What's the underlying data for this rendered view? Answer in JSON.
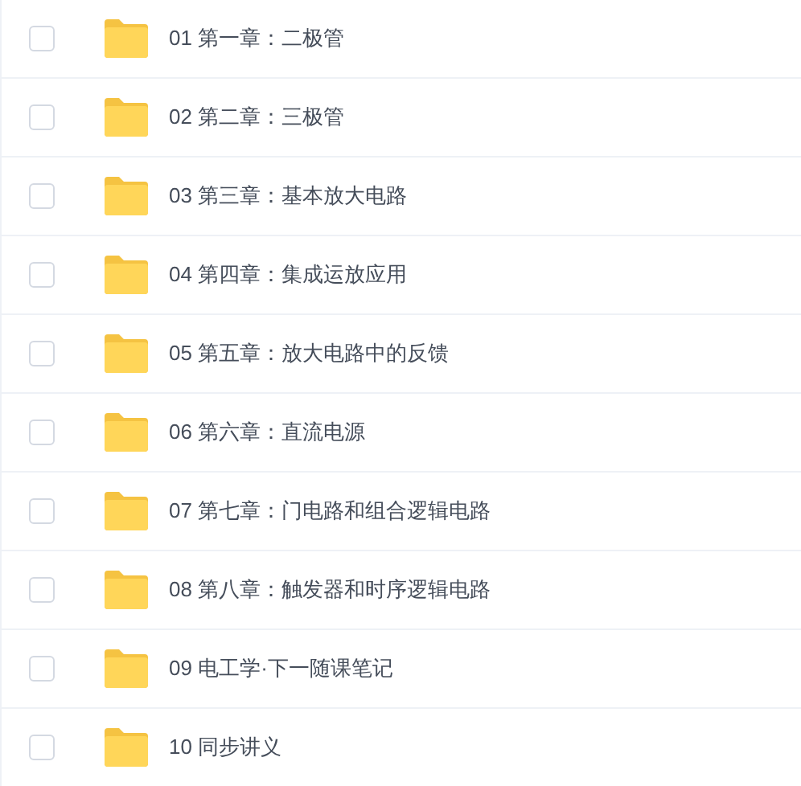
{
  "files": [
    {
      "name": "01 第一章：二极管",
      "checked": false
    },
    {
      "name": "02 第二章：三极管",
      "checked": false
    },
    {
      "name": "03 第三章：基本放大电路",
      "checked": false
    },
    {
      "name": "04 第四章：集成运放应用",
      "checked": false
    },
    {
      "name": "05 第五章：放大电路中的反馈",
      "checked": false
    },
    {
      "name": "06 第六章：直流电源",
      "checked": false
    },
    {
      "name": "07 第七章：门电路和组合逻辑电路",
      "checked": false
    },
    {
      "name": "08 第八章：触发器和时序逻辑电路",
      "checked": false
    },
    {
      "name": "09 电工学·下一随课笔记",
      "checked": false
    },
    {
      "name": "10 同步讲义",
      "checked": false
    }
  ]
}
